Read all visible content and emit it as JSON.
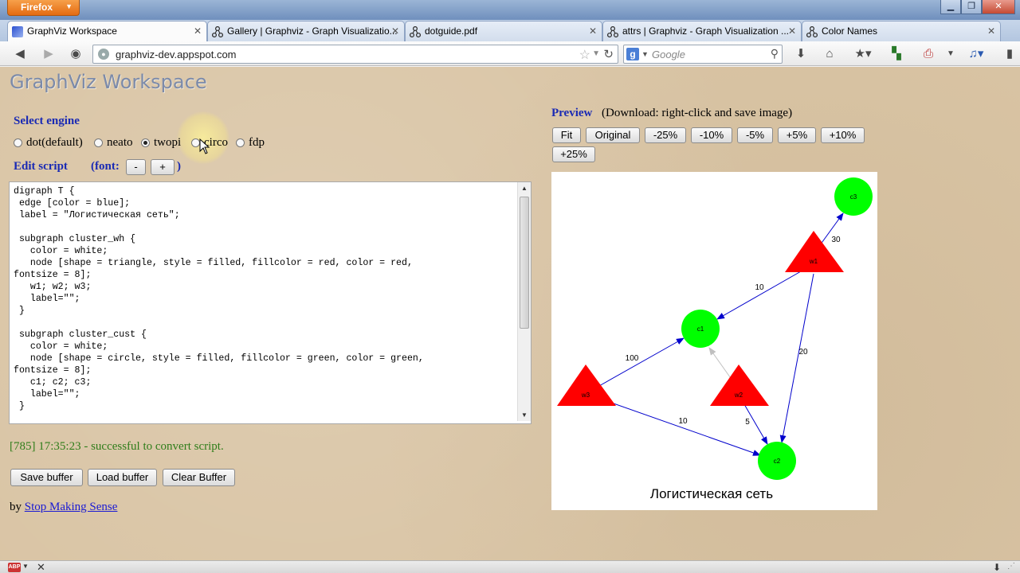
{
  "browser": {
    "menu_label": "Firefox",
    "tabs": [
      {
        "title": "GraphViz Workspace"
      },
      {
        "title": "Gallery | Graphviz - Graph Visualizatio..."
      },
      {
        "title": "dotguide.pdf"
      },
      {
        "title": "attrs | Graphviz - Graph Visualization ..."
      },
      {
        "title": "Color Names"
      }
    ],
    "url": "graphviz-dev.appspot.com",
    "search_placeholder": "Google"
  },
  "app": {
    "title": "GraphViz Workspace",
    "select_engine_label": "Select engine",
    "engines": [
      {
        "label": "dot(default)",
        "selected": false
      },
      {
        "label": "neato",
        "selected": false
      },
      {
        "label": "twopi",
        "selected": true
      },
      {
        "label": "circo",
        "selected": false
      },
      {
        "label": "fdp",
        "selected": false
      }
    ],
    "edit_script_label": "Edit script",
    "font_open": "(font:",
    "font_minus": "-",
    "font_plus": "+",
    "font_close": ")",
    "script": "digraph T {\n edge [color = blue];\n label = \"Логистическая сеть\";\n\n subgraph cluster_wh {\n   color = white;\n   node [shape = triangle, style = filled, fillcolor = red, color = red,\nfontsize = 8];\n   w1; w2; w3;\n   label=\"\";\n }\n\n subgraph cluster_cust {\n   color = white;\n   node [shape = circle, style = filled, fillcolor = green, color = green,\nfontsize = 8];\n   c1; c2; c3;\n   label=\"\";\n }",
    "status": "[785] 17:35:23 - successful to convert script.",
    "buttons": {
      "save": "Save buffer",
      "load": "Load buffer",
      "clear": "Clear Buffer"
    },
    "byline_prefix": "by",
    "byline_link": "Stop Making Sense"
  },
  "preview": {
    "label": "Preview",
    "hint": "(Download: right-click and save image)",
    "zoom_buttons": [
      "Fit",
      "Original",
      "-25%",
      "-10%",
      "-5%",
      "+5%",
      "+10%",
      "+25%"
    ],
    "graph": {
      "label": "Логистическая сеть",
      "node_colors": {
        "warehouse": "#ff0000",
        "customer": "#00ff00"
      },
      "edge_color": "#0000cc",
      "nodes": [
        {
          "id": "w1",
          "shape": "triangle"
        },
        {
          "id": "w2",
          "shape": "triangle"
        },
        {
          "id": "w3",
          "shape": "triangle"
        },
        {
          "id": "c1",
          "shape": "circle"
        },
        {
          "id": "c2",
          "shape": "circle"
        },
        {
          "id": "c3",
          "shape": "circle"
        }
      ],
      "edges": [
        {
          "from": "w1",
          "to": "c3",
          "label": "30"
        },
        {
          "from": "w1",
          "to": "c1",
          "label": "10"
        },
        {
          "from": "w1",
          "to": "c2",
          "label": "20"
        },
        {
          "from": "w3",
          "to": "c1",
          "label": "100"
        },
        {
          "from": "w3",
          "to": "c2",
          "label": "10"
        },
        {
          "from": "w2",
          "to": "c2",
          "label": "5"
        },
        {
          "from": "w2",
          "to": "c1",
          "label": ""
        }
      ]
    }
  }
}
